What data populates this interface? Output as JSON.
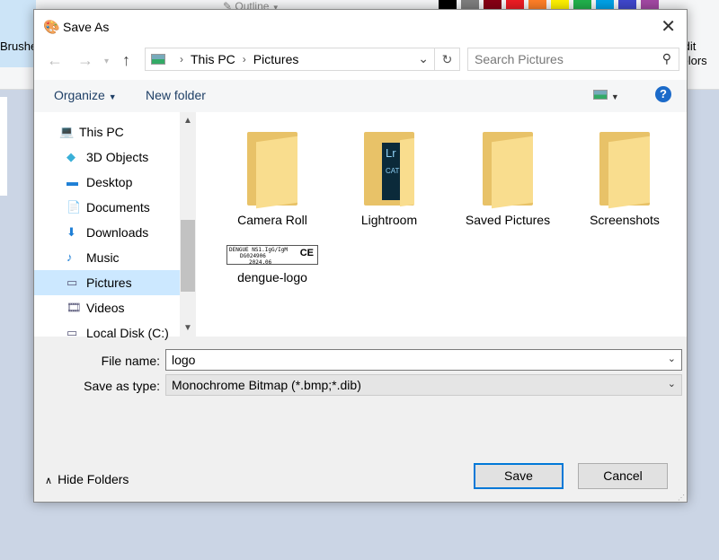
{
  "background_app": {
    "brushes_label": "Brushes",
    "edit_colors_label": "Edit colors",
    "outline_label": "Outline",
    "palette": [
      "#000000",
      "#7f7f7f",
      "#880015",
      "#ed1c24",
      "#ff7f27",
      "#fff200",
      "#22b14c",
      "#00a2e8",
      "#3f48cc",
      "#a349a4"
    ]
  },
  "dialog": {
    "title": "Save As",
    "breadcrumb": [
      "This PC",
      "Pictures"
    ],
    "search_placeholder": "Search Pictures",
    "toolbar": {
      "organize": "Organize",
      "new_folder": "New folder",
      "help": "?"
    },
    "tree": [
      {
        "label": "This PC",
        "icon": "computer-icon"
      },
      {
        "label": "3D Objects",
        "icon": "cube-icon"
      },
      {
        "label": "Desktop",
        "icon": "desktop-icon"
      },
      {
        "label": "Documents",
        "icon": "document-icon"
      },
      {
        "label": "Downloads",
        "icon": "download-icon"
      },
      {
        "label": "Music",
        "icon": "music-icon"
      },
      {
        "label": "Pictures",
        "icon": "pictures-icon",
        "selected": true
      },
      {
        "label": "Videos",
        "icon": "video-icon"
      },
      {
        "label": "Local Disk (C:)",
        "icon": "disk-icon"
      }
    ],
    "files": [
      {
        "name": "Camera Roll",
        "type": "folder"
      },
      {
        "name": "Lightroom",
        "type": "folder",
        "overlay": "Lr",
        "overlay_sub": "CAT"
      },
      {
        "name": "Saved Pictures",
        "type": "folder"
      },
      {
        "name": "Screenshots",
        "type": "folder"
      },
      {
        "name": "dengue-logo",
        "type": "image",
        "thumb_lines": [
          "DENGUE NS1.IgG/IgM",
          "DG024906",
          "2024.06"
        ],
        "thumb_mark": "CE"
      }
    ],
    "file_name_label": "File name:",
    "file_name": "logo",
    "save_type_label": "Save as type:",
    "save_type": "Monochrome Bitmap (*.bmp;*.dib)",
    "hide_folders": "Hide Folders",
    "save": "Save",
    "cancel": "Cancel"
  }
}
